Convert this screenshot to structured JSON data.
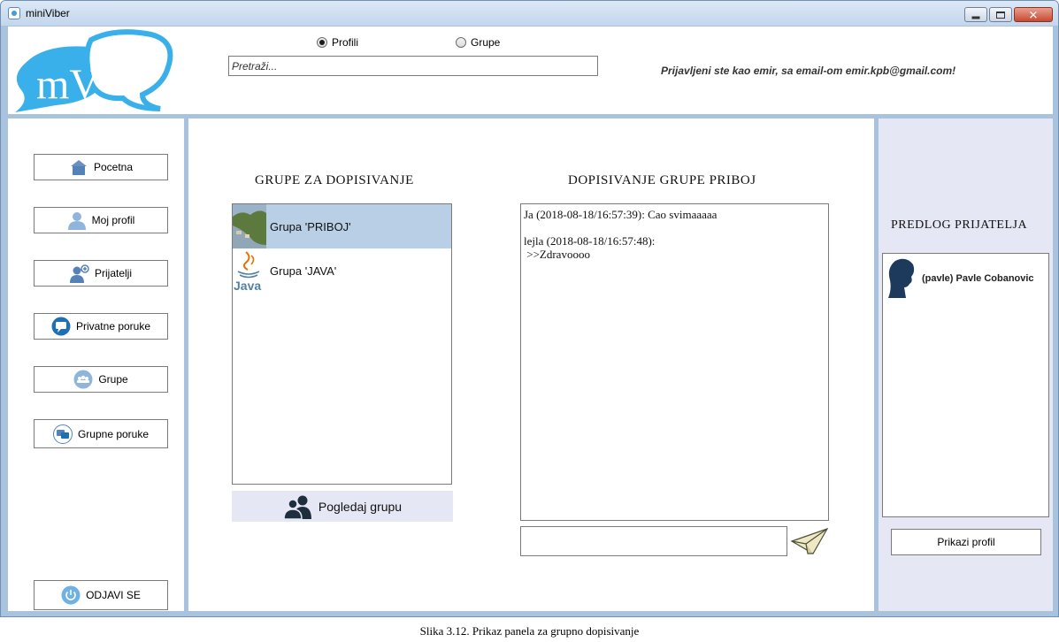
{
  "window": {
    "title": "miniViber"
  },
  "header": {
    "logo_text": "mV",
    "radio_profili": "Profili",
    "radio_grupe": "Grupe",
    "selected": "Profili",
    "search_placeholder": "Pretraži...",
    "login_info": "Prijavljeni ste kao emir, sa email-om emir.kpb@gmail.com!"
  },
  "nav": {
    "items": [
      {
        "label": "Pocetna",
        "icon": "home-icon"
      },
      {
        "label": "Moj profil",
        "icon": "user-icon"
      },
      {
        "label": "Prijatelji",
        "icon": "friends-icon"
      },
      {
        "label": "Privatne poruke",
        "icon": "chat-bubble-icon"
      },
      {
        "label": "Grupe",
        "icon": "group-icon"
      },
      {
        "label": "Grupne poruke",
        "icon": "group-messages-icon"
      }
    ],
    "logout": {
      "label": "ODJAVI SE",
      "icon": "power-icon"
    }
  },
  "groups": {
    "title": "GRUPE ZA DOPISIVANJE",
    "items": [
      {
        "label": "Grupa 'PRIBOJ'",
        "selected": true,
        "thumb": "landscape-thumbnail"
      },
      {
        "label": "Grupa 'JAVA'",
        "selected": false,
        "thumb": "java-logo"
      }
    ],
    "view_button": "Pogledaj grupu"
  },
  "chat": {
    "title": "DOPISIVANJE GRUPE PRIBOJ",
    "lines": [
      "Ja (2018-08-18/16:57:39): Cao svimaaaaa",
      "",
      "lejla (2018-08-18/16:57:48):",
      " >>Zdravoooo"
    ],
    "input_value": ""
  },
  "suggestions": {
    "title": "PREDLOG PRIJATELJA",
    "friends": [
      {
        "label": "(pavle) Pavle Cobanovic",
        "icon": "profile-silhouette-icon"
      }
    ],
    "show_profile_button": "Prikazi profil"
  },
  "colors": {
    "frame": "#a9c3df",
    "selected_row": "#b8cfe6",
    "panel_tint": "#e6e7f5",
    "logo_blue": "#3ab0ea"
  },
  "caption": "Slika 3.12. Prikaz panela za grupno dopisivanje"
}
